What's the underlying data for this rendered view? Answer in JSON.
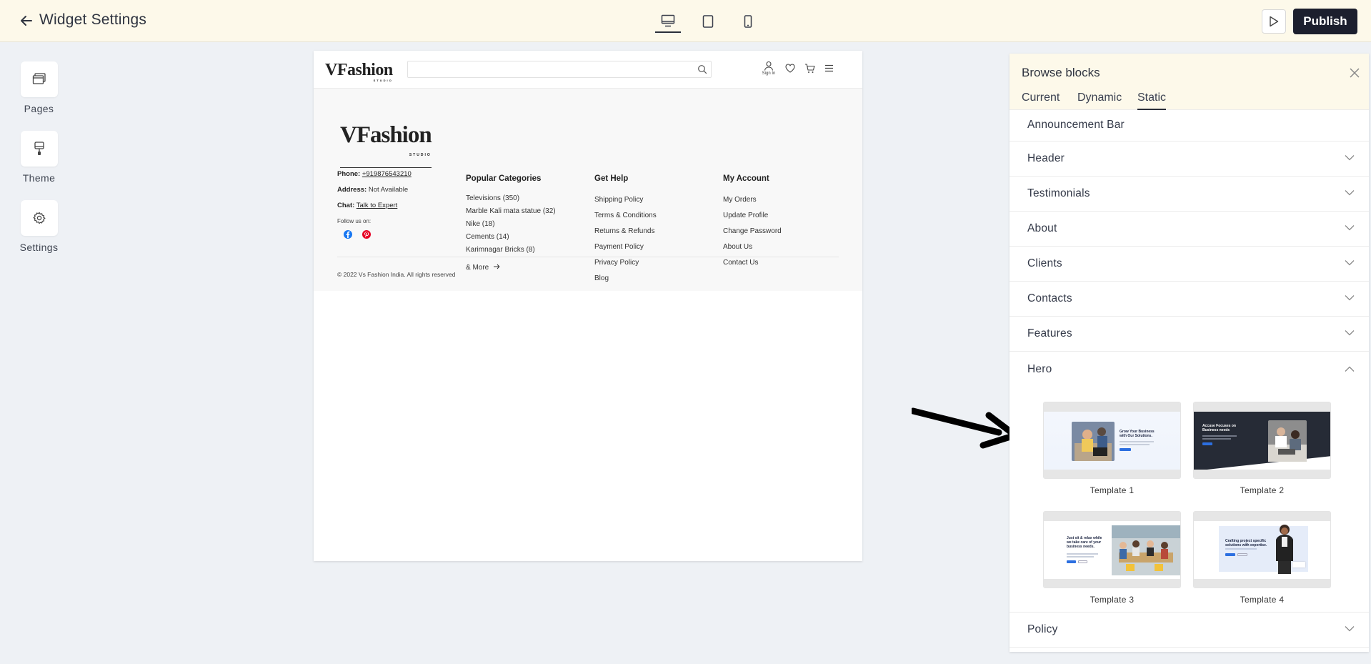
{
  "topbar": {
    "title": "Widget Settings",
    "devices": [
      "desktop-icon",
      "tablet-icon",
      "mobile-icon"
    ],
    "active_device": "desktop",
    "publish_label": "Publish"
  },
  "rail": {
    "items": [
      {
        "label": "Pages",
        "icon": "pages-icon"
      },
      {
        "label": "Theme",
        "icon": "theme-brush-icon"
      },
      {
        "label": "Settings",
        "icon": "gear-icon"
      }
    ]
  },
  "site": {
    "logo": "VFashion",
    "logo_sub": "STUDIO",
    "sign_in": "Sign In",
    "phone_label": "Phone:",
    "phone": "+919876543210",
    "address_label": "Address:",
    "address": "Not Available",
    "chat_label": "Chat:",
    "chat": "Talk to Expert",
    "follow": "Follow us on:",
    "columns": {
      "categories": {
        "title": "Popular Categories",
        "links": [
          "Televisions (350)",
          "Marble Kali mata statue (32)",
          "Nike (18)",
          "Cements (14)",
          "Karimnagar Bricks (8)"
        ],
        "more": "& More"
      },
      "help": {
        "title": "Get Help",
        "links": [
          "Shipping Policy",
          "Terms & Conditions",
          "Returns & Refunds",
          "Payment Policy",
          "Privacy Policy",
          "Blog"
        ]
      },
      "account": {
        "title": "My Account",
        "links": [
          "My Orders",
          "Update Profile",
          "Change Password",
          "About Us",
          "Contact Us"
        ]
      }
    },
    "copyright": "© 2022 Vs Fashion India. All rights reserved"
  },
  "panel": {
    "title": "Browse blocks",
    "tabs": [
      "Current",
      "Dynamic",
      "Static"
    ],
    "active_tab": "Static",
    "blocks": [
      "Announcement Bar",
      "Header",
      "Testimonials",
      "About",
      "Clients",
      "Contacts",
      "Features",
      "Hero",
      "Policy"
    ],
    "expanded": "Hero",
    "templates": [
      {
        "label": "Template 1",
        "headline": "Grow Your Business with Our Solutions."
      },
      {
        "label": "Template 2",
        "headline": "Accuse Focuses on Business needs"
      },
      {
        "label": "Template 3",
        "headline": "Just sit & relax while we take care of your business needs."
      },
      {
        "label": "Template 4",
        "headline": "Crafting project specific solutions with expertise."
      }
    ]
  },
  "colors": {
    "topbar_bg": "#fdf9ea",
    "publish_bg": "#1c1f2e",
    "canvas_bg": "#eef1f5",
    "facebook": "#1877f2",
    "pinterest": "#e60023"
  }
}
